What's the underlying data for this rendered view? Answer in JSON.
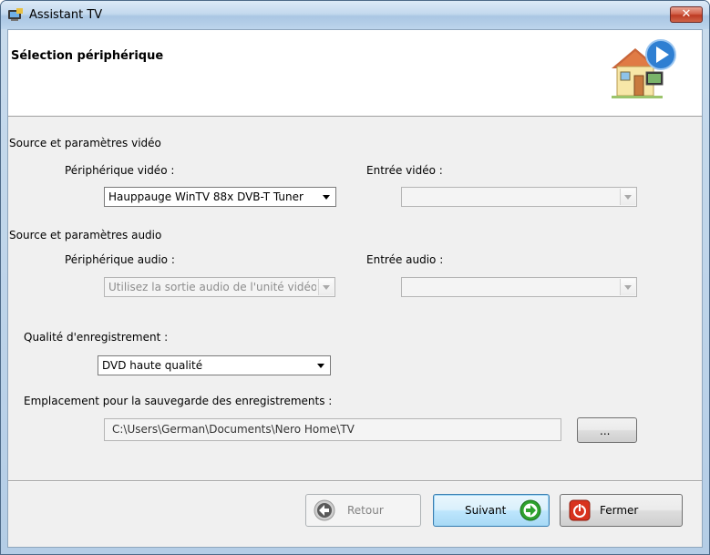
{
  "window": {
    "title": "Assistant TV",
    "close_label": "✕"
  },
  "header": {
    "title": "Sélection périphérique"
  },
  "video": {
    "section_label": "Source et paramètres vidéo",
    "device_label": "Périphérique vidéo :",
    "device_value": "Hauppauge WinTV 88x DVB-T Tuner",
    "input_label": "Entrée vidéo :",
    "input_value": ""
  },
  "audio": {
    "section_label": "Source et paramètres audio",
    "device_label": "Périphérique audio :",
    "device_value": "Utilisez la sortie audio de l'unité vidéo",
    "input_label": "Entrée audio :",
    "input_value": ""
  },
  "quality": {
    "label": "Qualité d'enregistrement :",
    "value": "DVD haute qualité"
  },
  "save_location": {
    "label": "Emplacement pour la sauvegarde des enregistrements :",
    "path": "C:\\Users\\German\\Documents\\Nero Home\\TV",
    "browse_label": "..."
  },
  "buttons": {
    "back": "Retour",
    "next": "Suivant",
    "close": "Fermer"
  },
  "icons": {
    "app": "tv-icon",
    "header": "house-play-icon",
    "back": "back-arrow-icon",
    "next": "next-arrow-icon",
    "close": "power-icon"
  },
  "colors": {
    "next_accent": "#2ea22e",
    "close_accent": "#d8331e",
    "play_accent": "#2f7fd2"
  }
}
